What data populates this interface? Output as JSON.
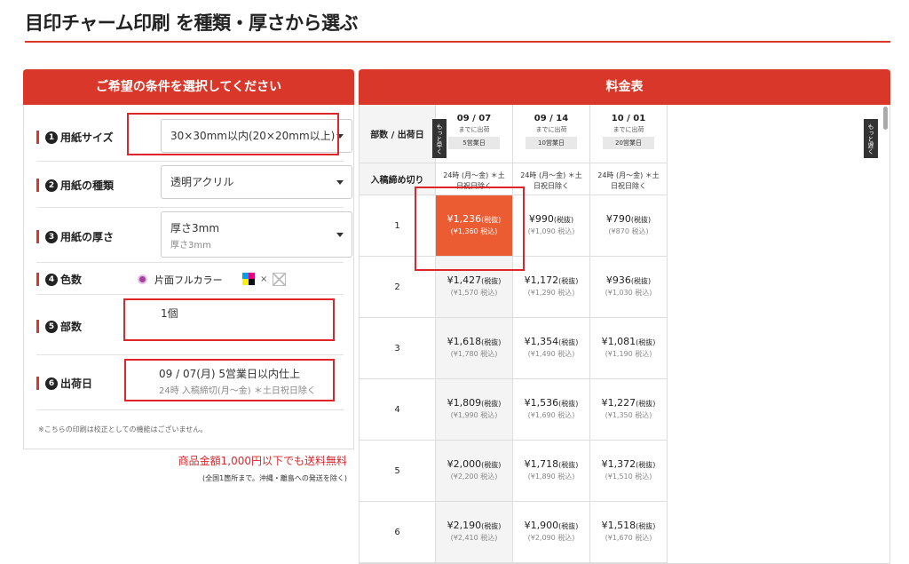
{
  "page": {
    "title": "目印チャーム印刷 を種類・厚さから選ぶ"
  },
  "left": {
    "header": "ご希望の条件を選択してください",
    "options": [
      {
        "num": "❶",
        "label": "用紙サイズ",
        "value": "30×30mm以内(20×20mm以上)"
      },
      {
        "num": "❷",
        "label": "用紙の種類",
        "value": "透明アクリル"
      },
      {
        "num": "❸",
        "label": "用紙の厚さ",
        "value": "厚さ3mm",
        "sub": "厚さ3mm"
      },
      {
        "num": "❹",
        "label": "色数",
        "value": "片面フルカラー",
        "times": "×"
      },
      {
        "num": "❺",
        "label": "部数",
        "value": "1個"
      },
      {
        "num": "❻",
        "label": "出荷日",
        "value": "09 / 07(月) 5営業日以内仕上",
        "sub": "24時 入稿締切(月〜金) ＊土日祝日除く"
      }
    ],
    "note": "※こちらの印刷は校正としての機能はございません。",
    "shipping": "商品金額1,000円以下でも送料無料",
    "shipping_sub": "(全国1箇所まで。沖縄・離島への発送を除く)"
  },
  "right": {
    "header": "料金表",
    "corner_label": "部数 / 出荷日",
    "cutoff_label": "入稿締め切り",
    "prev_label": "もっと早く",
    "next_label": "もっと遅く",
    "dates": [
      {
        "date": "09 / 07",
        "mid": "までに出荷",
        "badge": "5営業日",
        "cutoff": "24時 (月〜金) ＊土日祝日除く"
      },
      {
        "date": "09 / 14",
        "mid": "までに出荷",
        "badge": "10営業日",
        "cutoff": "24時 (月〜金) ＊土日祝日除く"
      },
      {
        "date": "10 / 01",
        "mid": "までに出荷",
        "badge": "20営業日",
        "cutoff": "24時 (月〜金) ＊土日祝日除く"
      }
    ],
    "tax_excl": "(税抜)",
    "rows": [
      {
        "qty": "1",
        "prices": [
          {
            "p": "¥1,236",
            "t": "(¥1,360 税込)"
          },
          {
            "p": "¥990",
            "t": "(¥1,090 税込)"
          },
          {
            "p": "¥790",
            "t": "(¥870 税込)"
          }
        ]
      },
      {
        "qty": "2",
        "prices": [
          {
            "p": "¥1,427",
            "t": "(¥1,570 税込)"
          },
          {
            "p": "¥1,172",
            "t": "(¥1,290 税込)"
          },
          {
            "p": "¥936",
            "t": "(¥1,030 税込)"
          }
        ]
      },
      {
        "qty": "3",
        "prices": [
          {
            "p": "¥1,618",
            "t": "(¥1,780 税込)"
          },
          {
            "p": "¥1,354",
            "t": "(¥1,490 税込)"
          },
          {
            "p": "¥1,081",
            "t": "(¥1,190 税込)"
          }
        ]
      },
      {
        "qty": "4",
        "prices": [
          {
            "p": "¥1,809",
            "t": "(¥1,990 税込)"
          },
          {
            "p": "¥1,536",
            "t": "(¥1,690 税込)"
          },
          {
            "p": "¥1,227",
            "t": "(¥1,350 税込)"
          }
        ]
      },
      {
        "qty": "5",
        "prices": [
          {
            "p": "¥2,000",
            "t": "(¥2,200 税込)"
          },
          {
            "p": "¥1,718",
            "t": "(¥1,890 税込)"
          },
          {
            "p": "¥1,372",
            "t": "(¥1,510 税込)"
          }
        ]
      },
      {
        "qty": "6",
        "prices": [
          {
            "p": "¥2,190",
            "t": "(¥2,410 税込)"
          },
          {
            "p": "¥1,900",
            "t": "(¥2,090 税込)"
          },
          {
            "p": "¥1,518",
            "t": "(¥1,670 税込)"
          }
        ]
      }
    ]
  },
  "colors": {
    "accent": "#d8372a",
    "selected": "#ec5c33",
    "highlight": "#e0252a"
  }
}
